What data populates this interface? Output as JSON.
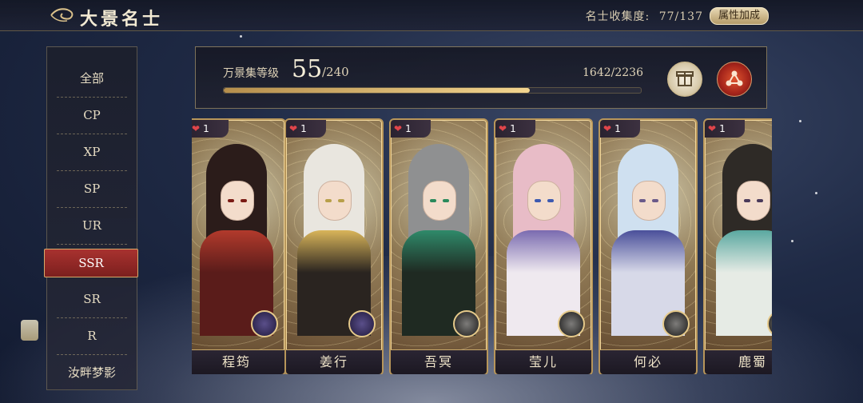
{
  "header": {
    "title": "大景名士",
    "collection_label": "名士收集度:",
    "collection_value": "77/137",
    "attr_button": "属性加成"
  },
  "menu": {
    "items": [
      "全部",
      "CP",
      "XP",
      "SP",
      "UR",
      "SSR",
      "SR",
      "R",
      "汝畔梦影"
    ],
    "active_index": 5
  },
  "level": {
    "label": "万景集等级",
    "value": "55",
    "max": "/240",
    "points": "1642/2236",
    "progress_fraction": 0.734
  },
  "cards": [
    {
      "name": "程筠",
      "likes": "1",
      "hair": "#2b1c1a",
      "robe": "#5a1c1a",
      "accent": "#b23a2c",
      "eye": "#7a1a14",
      "emblem": "purple"
    },
    {
      "name": "姜行",
      "likes": "1",
      "hair": "#e9e6df",
      "robe": "#2a2420",
      "accent": "#d9b55a",
      "eye": "#b8a04a",
      "emblem": "purple"
    },
    {
      "name": "吾冥",
      "likes": "1",
      "hair": "#8f9091",
      "robe": "#1f2a22",
      "accent": "#2f8a6a",
      "eye": "#2a8a5c",
      "emblem": "silver"
    },
    {
      "name": "莹儿",
      "likes": "1",
      "hair": "#e8bcc7",
      "robe": "#efe9ef",
      "accent": "#7a6bb0",
      "eye": "#3d5ab0",
      "emblem": "silver"
    },
    {
      "name": "何必",
      "likes": "1",
      "hair": "#cfe0f0",
      "robe": "#d7d9e8",
      "accent": "#4a4f9a",
      "eye": "#6a5a8a",
      "emblem": "silver"
    },
    {
      "name": "鹿蜀",
      "likes": "1",
      "hair": "#2e2a26",
      "robe": "#e6ebe5",
      "accent": "#5aa8a0",
      "eye": "#4a3a5a",
      "emblem": "silver"
    }
  ],
  "icons": {
    "back": "back-ornament-icon",
    "gift": "gift-box-icon",
    "share": "share-icon",
    "heart": "heart-icon"
  }
}
